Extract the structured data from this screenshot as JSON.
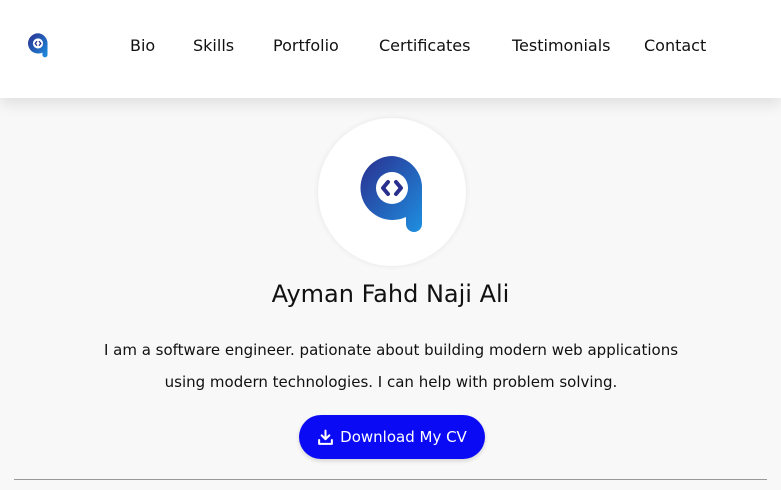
{
  "nav": {
    "logo_icon": "brand-a-code-logo-icon",
    "links": [
      "Bio",
      "Skills",
      "Portfolio",
      "Certificates",
      "Testimonials",
      "Contact"
    ]
  },
  "profile": {
    "logo_icon": "brand-a-code-logo-icon",
    "name": "Ayman Fahd Naji Ali",
    "bio_line1": "I am a software engineer. pationate about building modern web applications",
    "bio_line2": "using modern technologies. I can help with problem solving."
  },
  "cv_button": {
    "icon": "download-icon",
    "label": "Download My CV"
  },
  "colors": {
    "accent": "#0a0af5",
    "logo_dark": "#2a2f8f",
    "logo_light": "#1e8fe0"
  }
}
